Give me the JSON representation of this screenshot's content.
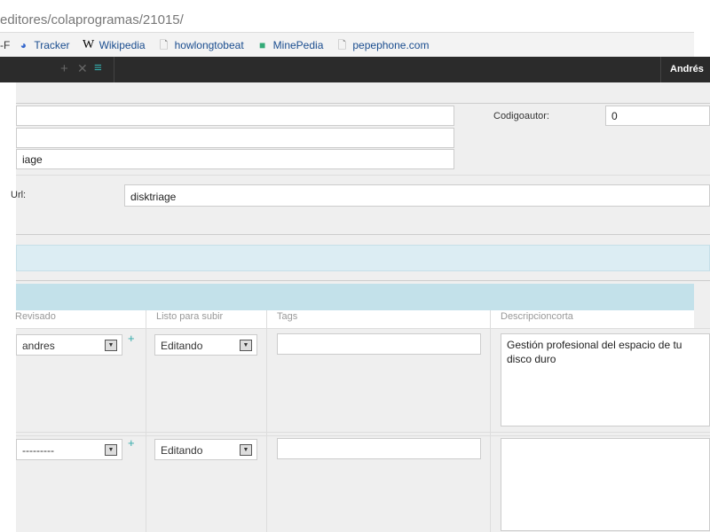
{
  "browser": {
    "url": "editores/colaprogramas/21015/",
    "bookmarks": [
      {
        "label": "Tracker",
        "icon": "tracker-icon"
      },
      {
        "label": "Wikipedia",
        "icon": "wikipedia-icon"
      },
      {
        "label": "howlongtobeat",
        "icon": "page-icon"
      },
      {
        "label": "MinePedia",
        "icon": "cube-icon"
      },
      {
        "label": "pepephone.com",
        "icon": "page-icon"
      }
    ],
    "bm_cut": "-F"
  },
  "topbar": {
    "user": "Andrés"
  },
  "form": {
    "field3": "iage",
    "codigoautor_label": "Codigoautor:",
    "codigoautor": "0",
    "url_label": "Url:",
    "url": "disktriage"
  },
  "table": {
    "headers": [
      "Revisado",
      "Listo para subir",
      "Tags",
      "Descripcioncorta"
    ],
    "rows": [
      {
        "revisado": "andres",
        "listo": "Editando",
        "tags": "",
        "desc": "Gestión profesional del espacio de tu disco duro"
      },
      {
        "revisado": "---------",
        "listo": "Editando",
        "tags": "",
        "desc": ""
      }
    ]
  }
}
